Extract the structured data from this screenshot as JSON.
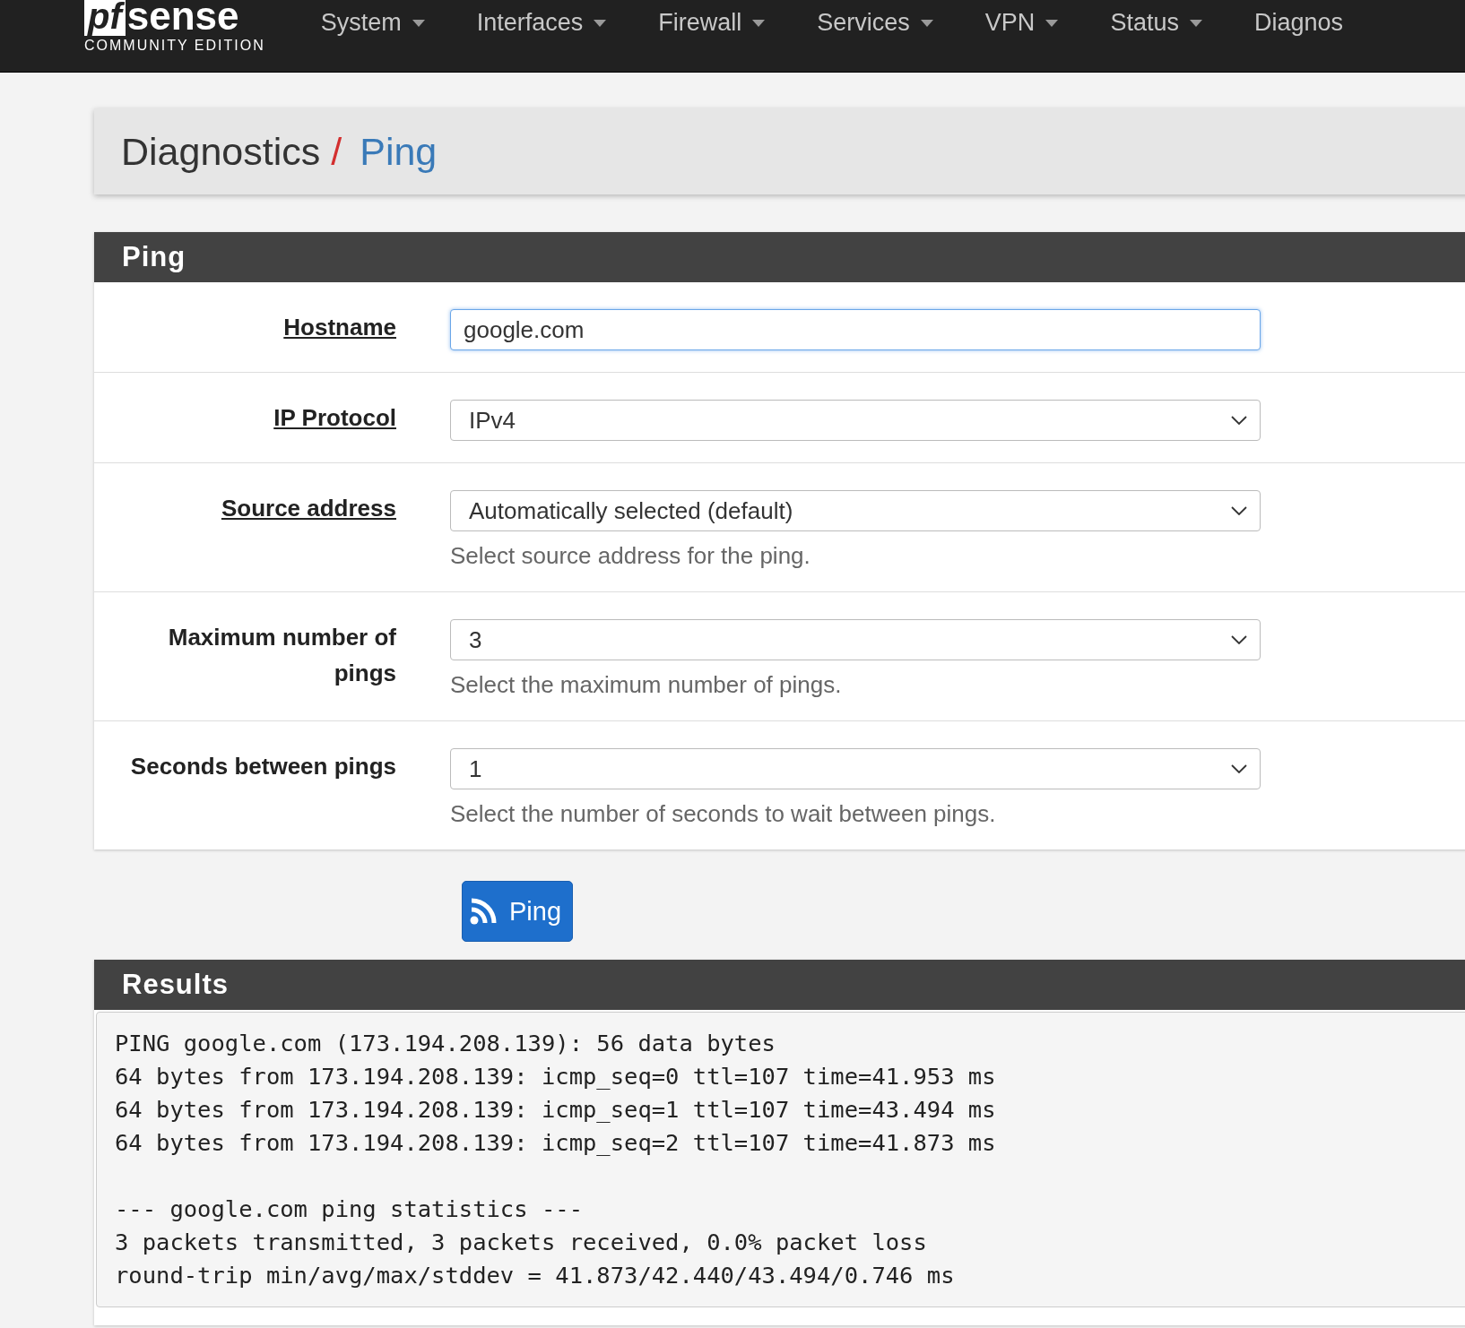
{
  "logo": {
    "mark": "pf",
    "word": "sense",
    "tagline": "COMMUNITY EDITION"
  },
  "nav": [
    {
      "label": "System",
      "dropdown": true
    },
    {
      "label": "Interfaces",
      "dropdown": true
    },
    {
      "label": "Firewall",
      "dropdown": true
    },
    {
      "label": "Services",
      "dropdown": true
    },
    {
      "label": "VPN",
      "dropdown": true
    },
    {
      "label": "Status",
      "dropdown": true
    },
    {
      "label": "Diagnos",
      "dropdown": false
    }
  ],
  "breadcrumb": {
    "parent": "Diagnostics",
    "separator": "/",
    "current": "Ping"
  },
  "ping_panel": {
    "title": "Ping",
    "rows": [
      {
        "label": "Hostname",
        "kind": "text",
        "value": "google.com",
        "focused": true,
        "has_help_link": true
      },
      {
        "label": "IP Protocol",
        "kind": "select",
        "value": "IPv4",
        "focused": false,
        "has_help_link": true
      },
      {
        "label": "Source address",
        "kind": "select",
        "value": "Automatically selected (default)",
        "focused": false,
        "has_help_link": true,
        "help": "Select source address for the ping."
      },
      {
        "label": "Maximum number of pings",
        "kind": "select",
        "value": "3",
        "focused": false,
        "has_help_link": false,
        "help": "Select the maximum number of pings."
      },
      {
        "label": "Seconds between pings",
        "kind": "select",
        "value": "1",
        "focused": false,
        "has_help_link": false,
        "help": "Select the number of seconds to wait between pings."
      }
    ]
  },
  "ping_button": {
    "label": "Ping"
  },
  "results_panel": {
    "title": "Results",
    "reply_lines": [
      "PING google.com (173.194.208.139): 56 data bytes",
      "64 bytes from 173.194.208.139: icmp_seq=0 ttl=107 time=41.953 ms",
      "64 bytes from 173.194.208.139: icmp_seq=1 ttl=107 time=43.494 ms",
      "64 bytes from 173.194.208.139: icmp_seq=2 ttl=107 time=41.873 ms"
    ],
    "statistics_lines": [
      "--- google.com ping statistics ---",
      "3 packets transmitted, 3 packets received, 0.0% packet loss",
      "round-trip min/avg/max/stddev = 41.873/42.440/43.494/0.746 ms"
    ]
  }
}
